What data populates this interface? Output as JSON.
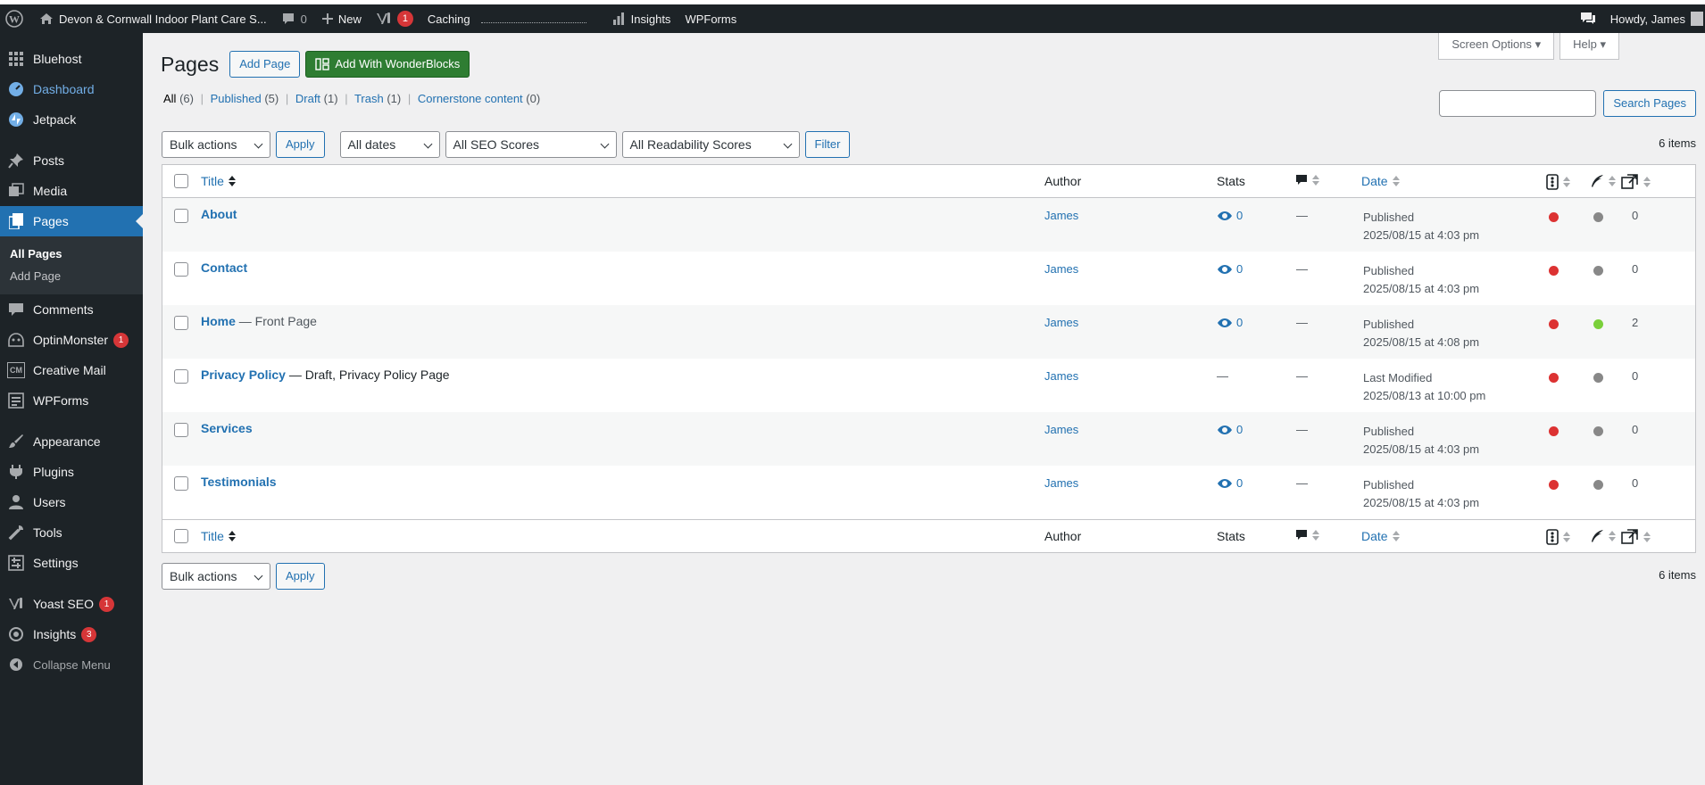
{
  "adminbar": {
    "site_name": "Devon & Cornwall Indoor Plant Care S...",
    "comments_count": "0",
    "new_label": "New",
    "yoast_badge": "1",
    "caching_label": "Caching",
    "insights_label": "Insights",
    "wpforms_label": "WPForms",
    "howdy": "Howdy, James"
  },
  "sidebar": {
    "bluehost": "Bluehost",
    "dashboard": "Dashboard",
    "jetpack": "Jetpack",
    "posts": "Posts",
    "media": "Media",
    "pages": "Pages",
    "sub_all_pages": "All Pages",
    "sub_add_page": "Add Page",
    "comments": "Comments",
    "optinmonster": "OptinMonster",
    "optinmonster_badge": "1",
    "creative_mail": "Creative Mail",
    "creative_mail_icon": "CM",
    "wpforms": "WPForms",
    "appearance": "Appearance",
    "plugins": "Plugins",
    "users": "Users",
    "tools": "Tools",
    "settings": "Settings",
    "yoast": "Yoast SEO",
    "yoast_badge": "1",
    "insights": "Insights",
    "insights_badge": "3",
    "collapse": "Collapse Menu"
  },
  "header": {
    "screen_options": "Screen Options",
    "help": "Help",
    "title": "Pages",
    "add_page": "Add Page",
    "add_wonderblocks": "Add With WonderBlocks"
  },
  "views": {
    "all": "All",
    "all_count": "(6)",
    "published": "Published",
    "published_count": "(5)",
    "draft": "Draft",
    "draft_count": "(1)",
    "trash": "Trash",
    "trash_count": "(1)",
    "cornerstone": "Cornerstone content",
    "cornerstone_count": "(0)"
  },
  "search": {
    "button": "Search Pages",
    "value": ""
  },
  "filters": {
    "bulk_actions": "Bulk actions",
    "apply": "Apply",
    "dates": "All dates",
    "seo": "All SEO Scores",
    "readability": "All Readability Scores",
    "filter": "Filter",
    "items_count": "6 items"
  },
  "table": {
    "columns": {
      "title": "Title",
      "author": "Author",
      "stats": "Stats",
      "date": "Date"
    },
    "rows": [
      {
        "title": "About",
        "state": "",
        "author": "James",
        "stats": "0",
        "comments": "—",
        "status": "Published",
        "date": "2025/08/15 at 4:03 pm",
        "seo": "red",
        "readability": "grey",
        "links": "0"
      },
      {
        "title": "Contact",
        "state": "",
        "author": "James",
        "stats": "0",
        "comments": "—",
        "status": "Published",
        "date": "2025/08/15 at 4:03 pm",
        "seo": "red",
        "readability": "grey",
        "links": "0"
      },
      {
        "title": "Home",
        "state": " — Front Page",
        "author": "James",
        "stats": "0",
        "comments": "—",
        "status": "Published",
        "date": "2025/08/15 at 4:08 pm",
        "seo": "red",
        "readability": "green",
        "links": "2"
      },
      {
        "title": "Privacy Policy",
        "state": " — Draft, Privacy Policy Page",
        "author": "James",
        "stats": "—",
        "comments": "—",
        "status": "Last Modified",
        "date": "2025/08/13 at 10:00 pm",
        "seo": "red",
        "readability": "grey",
        "links": "0"
      },
      {
        "title": "Services",
        "state": "",
        "author": "James",
        "stats": "0",
        "comments": "—",
        "status": "Published",
        "date": "2025/08/15 at 4:03 pm",
        "seo": "red",
        "readability": "grey",
        "links": "0"
      },
      {
        "title": "Testimonials",
        "state": "",
        "author": "James",
        "stats": "0",
        "comments": "—",
        "status": "Published",
        "date": "2025/08/15 at 4:03 pm",
        "seo": "red",
        "readability": "grey",
        "links": "0"
      }
    ]
  },
  "colors": {
    "admin_dark": "#1d2327",
    "accent": "#2271b1",
    "green_button": "#2e7d32",
    "seo_red": "#dc3232",
    "readability_green": "#7ad03a",
    "neutral_grey": "#888888"
  }
}
